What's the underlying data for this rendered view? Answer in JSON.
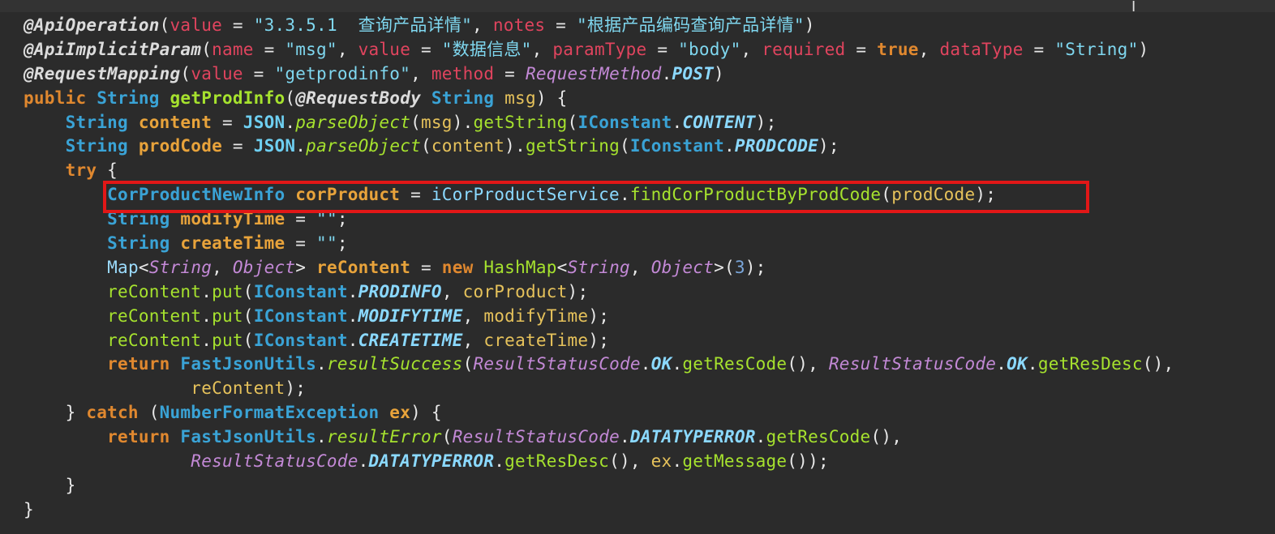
{
  "editor": {
    "lines": [
      [
        {
          "t": "@ApiOperation",
          "c": "ann"
        },
        {
          "t": "(",
          "c": "punc"
        },
        {
          "t": "value",
          "c": "param"
        },
        {
          "t": " = ",
          "c": "punc"
        },
        {
          "t": "\"3.3.5.1  查询产品详情\"",
          "c": "str"
        },
        {
          "t": ", ",
          "c": "punc"
        },
        {
          "t": "notes",
          "c": "param"
        },
        {
          "t": " = ",
          "c": "punc"
        },
        {
          "t": "\"根据产品编码查询产品详情\"",
          "c": "str"
        },
        {
          "t": ")",
          "c": "punc"
        }
      ],
      [
        {
          "t": "@ApiImplicitParam",
          "c": "ann"
        },
        {
          "t": "(",
          "c": "punc"
        },
        {
          "t": "name",
          "c": "param"
        },
        {
          "t": " = ",
          "c": "punc"
        },
        {
          "t": "\"msg\"",
          "c": "str"
        },
        {
          "t": ", ",
          "c": "punc"
        },
        {
          "t": "value",
          "c": "param"
        },
        {
          "t": " = ",
          "c": "punc"
        },
        {
          "t": "\"数据信息\"",
          "c": "str"
        },
        {
          "t": ", ",
          "c": "punc"
        },
        {
          "t": "paramType",
          "c": "param"
        },
        {
          "t": " = ",
          "c": "punc"
        },
        {
          "t": "\"body\"",
          "c": "str"
        },
        {
          "t": ", ",
          "c": "punc"
        },
        {
          "t": "required",
          "c": "param"
        },
        {
          "t": " = ",
          "c": "punc"
        },
        {
          "t": "true",
          "c": "kw"
        },
        {
          "t": ", ",
          "c": "punc"
        },
        {
          "t": "dataType",
          "c": "param"
        },
        {
          "t": " = ",
          "c": "punc"
        },
        {
          "t": "\"String\"",
          "c": "str"
        },
        {
          "t": ")",
          "c": "punc"
        }
      ],
      [
        {
          "t": "@RequestMapping",
          "c": "ann"
        },
        {
          "t": "(",
          "c": "punc"
        },
        {
          "t": "value",
          "c": "param"
        },
        {
          "t": " = ",
          "c": "punc"
        },
        {
          "t": "\"getprodinfo\"",
          "c": "str"
        },
        {
          "t": ", ",
          "c": "punc"
        },
        {
          "t": "method",
          "c": "param"
        },
        {
          "t": " = ",
          "c": "punc"
        },
        {
          "t": "RequestMethod",
          "c": "enumcls"
        },
        {
          "t": ".",
          "c": "punc"
        },
        {
          "t": "POST",
          "c": "const"
        },
        {
          "t": ")",
          "c": "punc"
        }
      ],
      [
        {
          "t": "public",
          "c": "kw"
        },
        {
          "t": " ",
          "c": "punc"
        },
        {
          "t": "String",
          "c": "type"
        },
        {
          "t": " ",
          "c": "punc"
        },
        {
          "t": "getProdInfo",
          "c": "fnb"
        },
        {
          "t": "(",
          "c": "punc"
        },
        {
          "t": "@RequestBody",
          "c": "ann"
        },
        {
          "t": " ",
          "c": "punc"
        },
        {
          "t": "String",
          "c": "type"
        },
        {
          "t": " ",
          "c": "punc"
        },
        {
          "t": "msg",
          "c": "var"
        },
        {
          "t": ") {",
          "c": "punc"
        }
      ],
      [
        {
          "t": "    ",
          "c": "punc"
        },
        {
          "t": "String",
          "c": "type"
        },
        {
          "t": " ",
          "c": "punc"
        },
        {
          "t": "content",
          "c": "lvar"
        },
        {
          "t": " = ",
          "c": "punc"
        },
        {
          "t": "JSON",
          "c": "cls"
        },
        {
          "t": ".",
          "c": "punc"
        },
        {
          "t": "parseObject",
          "c": "italfn"
        },
        {
          "t": "(",
          "c": "punc"
        },
        {
          "t": "msg",
          "c": "var"
        },
        {
          "t": ").",
          "c": "punc"
        },
        {
          "t": "getString",
          "c": "fn"
        },
        {
          "t": "(",
          "c": "punc"
        },
        {
          "t": "IConstant",
          "c": "type"
        },
        {
          "t": ".",
          "c": "punc"
        },
        {
          "t": "CONTENT",
          "c": "const"
        },
        {
          "t": ");",
          "c": "punc"
        }
      ],
      [
        {
          "t": "    ",
          "c": "punc"
        },
        {
          "t": "String",
          "c": "type"
        },
        {
          "t": " ",
          "c": "punc"
        },
        {
          "t": "prodCode",
          "c": "lvar"
        },
        {
          "t": " = ",
          "c": "punc"
        },
        {
          "t": "JSON",
          "c": "cls"
        },
        {
          "t": ".",
          "c": "punc"
        },
        {
          "t": "parseObject",
          "c": "italfn"
        },
        {
          "t": "(",
          "c": "punc"
        },
        {
          "t": "content",
          "c": "var"
        },
        {
          "t": ").",
          "c": "punc"
        },
        {
          "t": "getString",
          "c": "fn"
        },
        {
          "t": "(",
          "c": "punc"
        },
        {
          "t": "IConstant",
          "c": "type"
        },
        {
          "t": ".",
          "c": "punc"
        },
        {
          "t": "PRODCODE",
          "c": "const"
        },
        {
          "t": ");",
          "c": "punc"
        }
      ],
      [
        {
          "t": "    ",
          "c": "punc"
        },
        {
          "t": "try",
          "c": "kw"
        },
        {
          "t": " {",
          "c": "punc"
        }
      ],
      [
        {
          "t": "        ",
          "c": "punc"
        },
        {
          "t": "CorProductNewInfo",
          "c": "type"
        },
        {
          "t": " ",
          "c": "punc"
        },
        {
          "t": "corProduct",
          "c": "lvar"
        },
        {
          "t": " = ",
          "c": "punc"
        },
        {
          "t": "iCorProductService",
          "c": "field"
        },
        {
          "t": ".",
          "c": "punc"
        },
        {
          "t": "findCorProductByProdCode",
          "c": "fn"
        },
        {
          "t": "(",
          "c": "punc"
        },
        {
          "t": "prodCode",
          "c": "var"
        },
        {
          "t": ");",
          "c": "punc"
        }
      ],
      [
        {
          "t": "        ",
          "c": "punc"
        },
        {
          "t": "String",
          "c": "type"
        },
        {
          "t": " ",
          "c": "punc"
        },
        {
          "t": "modifyTime",
          "c": "lvar"
        },
        {
          "t": " = ",
          "c": "punc"
        },
        {
          "t": "\"\"",
          "c": "str"
        },
        {
          "t": ";",
          "c": "punc"
        }
      ],
      [
        {
          "t": "        ",
          "c": "punc"
        },
        {
          "t": "String",
          "c": "type"
        },
        {
          "t": " ",
          "c": "punc"
        },
        {
          "t": "createTime",
          "c": "lvar"
        },
        {
          "t": " = ",
          "c": "punc"
        },
        {
          "t": "\"\"",
          "c": "str"
        },
        {
          "t": ";",
          "c": "punc"
        }
      ],
      [
        {
          "t": "        ",
          "c": "punc"
        },
        {
          "t": "Map",
          "c": "plain"
        },
        {
          "t": "<",
          "c": "punc"
        },
        {
          "t": "String",
          "c": "enumcls"
        },
        {
          "t": ", ",
          "c": "punc"
        },
        {
          "t": "Object",
          "c": "enumcls"
        },
        {
          "t": "> ",
          "c": "punc"
        },
        {
          "t": "reContent",
          "c": "lvar"
        },
        {
          "t": " = ",
          "c": "punc"
        },
        {
          "t": "new",
          "c": "kw"
        },
        {
          "t": " ",
          "c": "punc"
        },
        {
          "t": "HashMap",
          "c": "fn"
        },
        {
          "t": "<",
          "c": "punc"
        },
        {
          "t": "String",
          "c": "enumcls"
        },
        {
          "t": ", ",
          "c": "punc"
        },
        {
          "t": "Object",
          "c": "enumcls"
        },
        {
          "t": ">(",
          "c": "punc"
        },
        {
          "t": "3",
          "c": "num"
        },
        {
          "t": ");",
          "c": "punc"
        }
      ],
      [
        {
          "t": "        ",
          "c": "punc"
        },
        {
          "t": "reContent",
          "c": "fn"
        },
        {
          "t": ".",
          "c": "punc"
        },
        {
          "t": "put",
          "c": "fn"
        },
        {
          "t": "(",
          "c": "punc"
        },
        {
          "t": "IConstant",
          "c": "type"
        },
        {
          "t": ".",
          "c": "punc"
        },
        {
          "t": "PRODINFO",
          "c": "const"
        },
        {
          "t": ", ",
          "c": "punc"
        },
        {
          "t": "corProduct",
          "c": "var"
        },
        {
          "t": ");",
          "c": "punc"
        }
      ],
      [
        {
          "t": "        ",
          "c": "punc"
        },
        {
          "t": "reContent",
          "c": "fn"
        },
        {
          "t": ".",
          "c": "punc"
        },
        {
          "t": "put",
          "c": "fn"
        },
        {
          "t": "(",
          "c": "punc"
        },
        {
          "t": "IConstant",
          "c": "type"
        },
        {
          "t": ".",
          "c": "punc"
        },
        {
          "t": "MODIFYTIME",
          "c": "const"
        },
        {
          "t": ", ",
          "c": "punc"
        },
        {
          "t": "modifyTime",
          "c": "var"
        },
        {
          "t": ");",
          "c": "punc"
        }
      ],
      [
        {
          "t": "        ",
          "c": "punc"
        },
        {
          "t": "reContent",
          "c": "fn"
        },
        {
          "t": ".",
          "c": "punc"
        },
        {
          "t": "put",
          "c": "fn"
        },
        {
          "t": "(",
          "c": "punc"
        },
        {
          "t": "IConstant",
          "c": "type"
        },
        {
          "t": ".",
          "c": "punc"
        },
        {
          "t": "CREATETIME",
          "c": "const"
        },
        {
          "t": ", ",
          "c": "punc"
        },
        {
          "t": "createTime",
          "c": "var"
        },
        {
          "t": ");",
          "c": "punc"
        }
      ],
      [
        {
          "t": "        ",
          "c": "punc"
        },
        {
          "t": "return",
          "c": "kw"
        },
        {
          "t": " ",
          "c": "punc"
        },
        {
          "t": "FastJsonUtils",
          "c": "type"
        },
        {
          "t": ".",
          "c": "punc"
        },
        {
          "t": "resultSuccess",
          "c": "italfn"
        },
        {
          "t": "(",
          "c": "punc"
        },
        {
          "t": "ResultStatusCode",
          "c": "enumcls"
        },
        {
          "t": ".",
          "c": "punc"
        },
        {
          "t": "OK",
          "c": "const"
        },
        {
          "t": ".",
          "c": "punc"
        },
        {
          "t": "getResCode",
          "c": "fn"
        },
        {
          "t": "(), ",
          "c": "punc"
        },
        {
          "t": "ResultStatusCode",
          "c": "enumcls"
        },
        {
          "t": ".",
          "c": "punc"
        },
        {
          "t": "OK",
          "c": "const"
        },
        {
          "t": ".",
          "c": "punc"
        },
        {
          "t": "getResDesc",
          "c": "fn"
        },
        {
          "t": "(),",
          "c": "punc"
        }
      ],
      [
        {
          "t": "                ",
          "c": "punc"
        },
        {
          "t": "reContent",
          "c": "var"
        },
        {
          "t": ");",
          "c": "punc"
        }
      ],
      [
        {
          "t": "    } ",
          "c": "punc"
        },
        {
          "t": "catch",
          "c": "kw"
        },
        {
          "t": " (",
          "c": "punc"
        },
        {
          "t": "NumberFormatException",
          "c": "type"
        },
        {
          "t": " ",
          "c": "punc"
        },
        {
          "t": "ex",
          "c": "lvar"
        },
        {
          "t": ") {",
          "c": "punc"
        }
      ],
      [
        {
          "t": "        ",
          "c": "punc"
        },
        {
          "t": "return",
          "c": "kw"
        },
        {
          "t": " ",
          "c": "punc"
        },
        {
          "t": "FastJsonUtils",
          "c": "type"
        },
        {
          "t": ".",
          "c": "punc"
        },
        {
          "t": "resultError",
          "c": "italfn"
        },
        {
          "t": "(",
          "c": "punc"
        },
        {
          "t": "ResultStatusCode",
          "c": "enumcls"
        },
        {
          "t": ".",
          "c": "punc"
        },
        {
          "t": "DATATYPERROR",
          "c": "const"
        },
        {
          "t": ".",
          "c": "punc"
        },
        {
          "t": "getResCode",
          "c": "fn"
        },
        {
          "t": "(),",
          "c": "punc"
        }
      ],
      [
        {
          "t": "                ",
          "c": "punc"
        },
        {
          "t": "ResultStatusCode",
          "c": "enumcls"
        },
        {
          "t": ".",
          "c": "punc"
        },
        {
          "t": "DATATYPERROR",
          "c": "const"
        },
        {
          "t": ".",
          "c": "punc"
        },
        {
          "t": "getResDesc",
          "c": "fn"
        },
        {
          "t": "(), ",
          "c": "punc"
        },
        {
          "t": "ex",
          "c": "var"
        },
        {
          "t": ".",
          "c": "punc"
        },
        {
          "t": "getMessage",
          "c": "fn"
        },
        {
          "t": "());",
          "c": "punc"
        }
      ],
      [
        {
          "t": "    }",
          "c": "punc"
        }
      ],
      [
        {
          "t": "}",
          "c": "punc"
        }
      ]
    ]
  },
  "highlight": {
    "color": "#e21717",
    "line_index": 7
  },
  "theme": {
    "background": "#2b2b2b"
  },
  "cursor": {
    "icon": "text-cursor-icon",
    "glyph": "I"
  }
}
